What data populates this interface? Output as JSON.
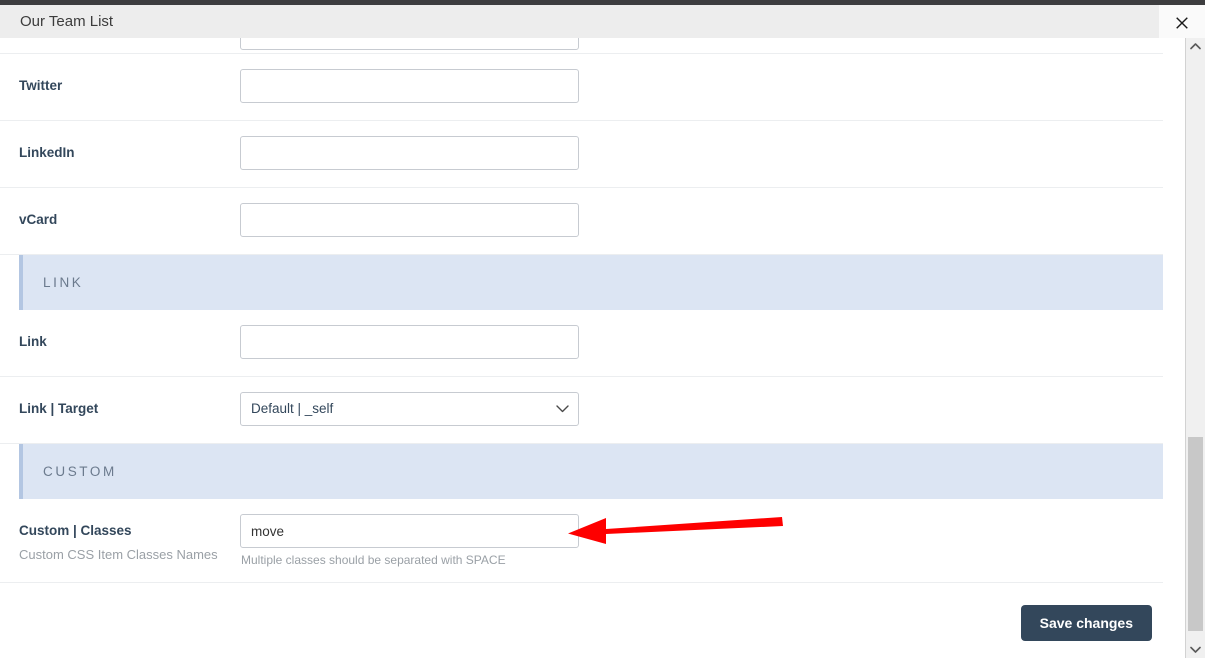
{
  "window": {
    "title": "Our Team List",
    "close_icon": "close-icon"
  },
  "scrollbar": {
    "up_icon": "chevron-up-icon",
    "down_icon": "chevron-down-icon"
  },
  "form": {
    "rows": [
      {
        "label": "Twitter",
        "value": "",
        "placeholder": ""
      },
      {
        "label": "LinkedIn",
        "value": "",
        "placeholder": ""
      },
      {
        "label": "vCard",
        "value": "",
        "placeholder": ""
      }
    ],
    "link_section": {
      "title": "LINK",
      "link": {
        "label": "Link",
        "value": "",
        "placeholder": ""
      },
      "target": {
        "label": "Link | Target",
        "selected": "Default | _self",
        "chevron_icon": "chevron-down-icon"
      }
    },
    "custom_section": {
      "title": "CUSTOM",
      "classes": {
        "label": "Custom | Classes",
        "sublabel": "Custom CSS Item Classes Names",
        "value": "move",
        "placeholder": "",
        "helper": "Multiple classes should be separated with SPACE"
      }
    }
  },
  "footer": {
    "save_label": "Save changes"
  },
  "annotation": {
    "arrow_color": "#fe0000",
    "arrow_icon": "left-arrow-annotation"
  }
}
